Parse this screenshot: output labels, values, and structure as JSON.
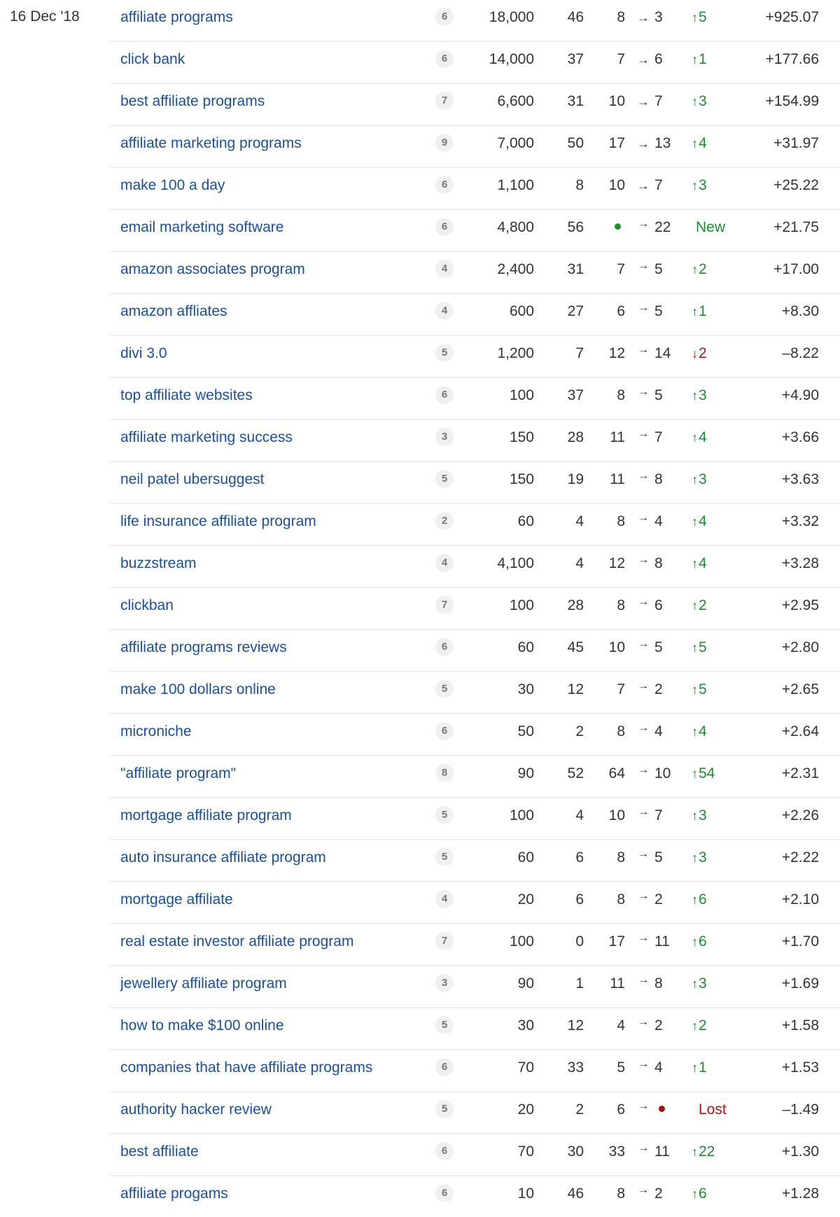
{
  "date_label": "16 Dec '18",
  "colors": {
    "link": "#1a4f9e",
    "up": "#1a8f2e",
    "down": "#b01510",
    "badge_bg": "#f0f0f0",
    "separator": "#eceef2"
  },
  "icons": {
    "arrow_right": "→",
    "arrow_up": "↑",
    "arrow_down": "↓"
  },
  "rows": [
    {
      "keyword": "affiliate programs",
      "kd": "6",
      "volume": "18,000",
      "kw_difficulty": "46",
      "pos_from": "8",
      "pos_to": "3",
      "change": "5",
      "change_dir": "up",
      "traffic": "+925.07"
    },
    {
      "keyword": "click bank",
      "kd": "6",
      "volume": "14,000",
      "kw_difficulty": "37",
      "pos_from": "7",
      "pos_to": "6",
      "change": "1",
      "change_dir": "up",
      "traffic": "+177.66"
    },
    {
      "keyword": "best affiliate programs",
      "kd": "7",
      "volume": "6,600",
      "kw_difficulty": "31",
      "pos_from": "10",
      "pos_to": "7",
      "change": "3",
      "change_dir": "up",
      "traffic": "+154.99"
    },
    {
      "keyword": "affiliate marketing programs",
      "kd": "9",
      "volume": "7,000",
      "kw_difficulty": "50",
      "pos_from": "17",
      "pos_to": "13",
      "change": "4",
      "change_dir": "up",
      "traffic": "+31.97"
    },
    {
      "keyword": "make 100 a day",
      "kd": "6",
      "volume": "1,100",
      "kw_difficulty": "8",
      "pos_from": "10",
      "pos_to": "7",
      "change": "3",
      "change_dir": "up",
      "traffic": "+25.22"
    },
    {
      "keyword": "email marketing software",
      "kd": "6",
      "volume": "4,800",
      "kw_difficulty": "56",
      "pos_from": "",
      "pos_to": "22",
      "change": "New",
      "change_dir": "new",
      "traffic": "+21.75"
    },
    {
      "keyword": "amazon associates program",
      "kd": "4",
      "volume": "2,400",
      "kw_difficulty": "31",
      "pos_from": "7",
      "pos_to": "5",
      "change": "2",
      "change_dir": "up",
      "traffic": "+17.00"
    },
    {
      "keyword": "amazon affliates",
      "kd": "4",
      "volume": "600",
      "kw_difficulty": "27",
      "pos_from": "6",
      "pos_to": "5",
      "change": "1",
      "change_dir": "up",
      "traffic": "+8.30"
    },
    {
      "keyword": "divi 3.0",
      "kd": "5",
      "volume": "1,200",
      "kw_difficulty": "7",
      "pos_from": "12",
      "pos_to": "14",
      "change": "2",
      "change_dir": "down",
      "traffic": "–8.22"
    },
    {
      "keyword": "top affiliate websites",
      "kd": "6",
      "volume": "100",
      "kw_difficulty": "37",
      "pos_from": "8",
      "pos_to": "5",
      "change": "3",
      "change_dir": "up",
      "traffic": "+4.90"
    },
    {
      "keyword": "affiliate marketing success",
      "kd": "3",
      "volume": "150",
      "kw_difficulty": "28",
      "pos_from": "11",
      "pos_to": "7",
      "change": "4",
      "change_dir": "up",
      "traffic": "+3.66"
    },
    {
      "keyword": "neil patel ubersuggest",
      "kd": "5",
      "volume": "150",
      "kw_difficulty": "19",
      "pos_from": "11",
      "pos_to": "8",
      "change": "3",
      "change_dir": "up",
      "traffic": "+3.63"
    },
    {
      "keyword": "life insurance affiliate program",
      "kd": "2",
      "volume": "60",
      "kw_difficulty": "4",
      "pos_from": "8",
      "pos_to": "4",
      "change": "4",
      "change_dir": "up",
      "traffic": "+3.32"
    },
    {
      "keyword": "buzzstream",
      "kd": "4",
      "volume": "4,100",
      "kw_difficulty": "4",
      "pos_from": "12",
      "pos_to": "8",
      "change": "4",
      "change_dir": "up",
      "traffic": "+3.28"
    },
    {
      "keyword": "clickban",
      "kd": "7",
      "volume": "100",
      "kw_difficulty": "28",
      "pos_from": "8",
      "pos_to": "6",
      "change": "2",
      "change_dir": "up",
      "traffic": "+2.95"
    },
    {
      "keyword": "affiliate programs reviews",
      "kd": "6",
      "volume": "60",
      "kw_difficulty": "45",
      "pos_from": "10",
      "pos_to": "5",
      "change": "5",
      "change_dir": "up",
      "traffic": "+2.80"
    },
    {
      "keyword": "make 100 dollars online",
      "kd": "5",
      "volume": "30",
      "kw_difficulty": "12",
      "pos_from": "7",
      "pos_to": "2",
      "change": "5",
      "change_dir": "up",
      "traffic": "+2.65"
    },
    {
      "keyword": "microniche",
      "kd": "6",
      "volume": "50",
      "kw_difficulty": "2",
      "pos_from": "8",
      "pos_to": "4",
      "change": "4",
      "change_dir": "up",
      "traffic": "+2.64"
    },
    {
      "keyword": "\"affiliate program\"",
      "kd": "8",
      "volume": "90",
      "kw_difficulty": "52",
      "pos_from": "64",
      "pos_to": "10",
      "change": "54",
      "change_dir": "up",
      "traffic": "+2.31"
    },
    {
      "keyword": "mortgage affiliate program",
      "kd": "5",
      "volume": "100",
      "kw_difficulty": "4",
      "pos_from": "10",
      "pos_to": "7",
      "change": "3",
      "change_dir": "up",
      "traffic": "+2.26"
    },
    {
      "keyword": "auto insurance affiliate program",
      "kd": "5",
      "volume": "60",
      "kw_difficulty": "6",
      "pos_from": "8",
      "pos_to": "5",
      "change": "3",
      "change_dir": "up",
      "traffic": "+2.22"
    },
    {
      "keyword": "mortgage affiliate",
      "kd": "4",
      "volume": "20",
      "kw_difficulty": "6",
      "pos_from": "8",
      "pos_to": "2",
      "change": "6",
      "change_dir": "up",
      "traffic": "+2.10"
    },
    {
      "keyword": "real estate investor affiliate program",
      "kd": "7",
      "volume": "100",
      "kw_difficulty": "0",
      "pos_from": "17",
      "pos_to": "11",
      "change": "6",
      "change_dir": "up",
      "traffic": "+1.70"
    },
    {
      "keyword": "jewellery affiliate program",
      "kd": "3",
      "volume": "90",
      "kw_difficulty": "1",
      "pos_from": "11",
      "pos_to": "8",
      "change": "3",
      "change_dir": "up",
      "traffic": "+1.69"
    },
    {
      "keyword": "how to make $100 online",
      "kd": "5",
      "volume": "30",
      "kw_difficulty": "12",
      "pos_from": "4",
      "pos_to": "2",
      "change": "2",
      "change_dir": "up",
      "traffic": "+1.58"
    },
    {
      "keyword": "companies that have affiliate programs",
      "kd": "6",
      "volume": "70",
      "kw_difficulty": "33",
      "pos_from": "5",
      "pos_to": "4",
      "change": "1",
      "change_dir": "up",
      "traffic": "+1.53"
    },
    {
      "keyword": "authority hacker review",
      "kd": "5",
      "volume": "20",
      "kw_difficulty": "2",
      "pos_from": "6",
      "pos_to": "",
      "change": "Lost",
      "change_dir": "lost",
      "traffic": "–1.49"
    },
    {
      "keyword": "best affiliate",
      "kd": "6",
      "volume": "70",
      "kw_difficulty": "30",
      "pos_from": "33",
      "pos_to": "11",
      "change": "22",
      "change_dir": "up",
      "traffic": "+1.30"
    },
    {
      "keyword": "affiliate progams",
      "kd": "6",
      "volume": "10",
      "kw_difficulty": "46",
      "pos_from": "8",
      "pos_to": "2",
      "change": "6",
      "change_dir": "up",
      "traffic": "+1.28"
    }
  ]
}
